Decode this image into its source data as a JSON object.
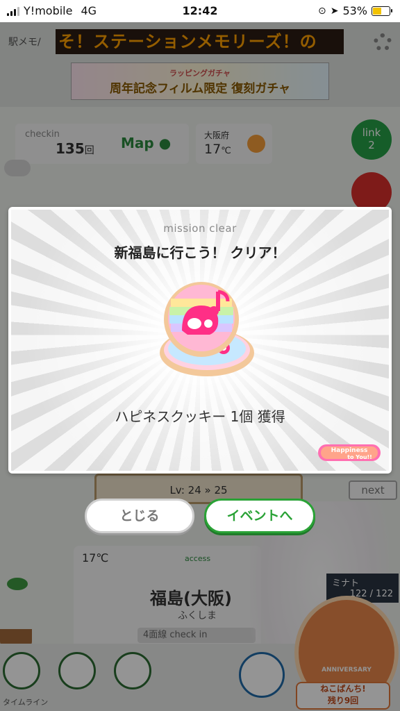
{
  "status_bar": {
    "carrier": "Y!mobile",
    "network": "4G",
    "time": "12:42",
    "battery_percent": "53%",
    "battery_level": 0.53
  },
  "background": {
    "memo_label": "駅メモ/",
    "marquee_text": "そ！ステーションメモリーズ！の",
    "banner": {
      "sub": "ラッピングガチャ",
      "main": "周年記念フィルム限定 復刻ガチャ"
    },
    "checkin": {
      "label": "checkin",
      "count": "135",
      "unit": "回",
      "map_label": "Map"
    },
    "weather": {
      "prefecture": "大阪府",
      "temperature": "17",
      "unit": "℃"
    },
    "link": {
      "label": "link",
      "count": "2"
    },
    "level": {
      "text": "Lv: 24 » 25"
    },
    "next_label": "next",
    "station_card": {
      "temperature": "17℃",
      "access_label": "access",
      "station_name": "福島(大阪)",
      "station_kana": "ふくしま",
      "check_label": "4面線 check in"
    },
    "character": {
      "name": "ミナト",
      "hp": "122 / 122"
    },
    "bottom_nav": {
      "timeline_label": "タイムライン"
    },
    "anniversary": {
      "badge_text": "ANNIVERSARY",
      "text_line1": "ねこぱんち!",
      "text_line2": "残り9回"
    }
  },
  "modal": {
    "subtitle": "mission clear",
    "title": "新福島に行こう！ クリア！",
    "reward_text": "ハピネスクッキー 1個 獲得",
    "logo_text_line1": "Happiness",
    "logo_text_line2": "to You!!"
  },
  "buttons": {
    "close_label": "とじる",
    "event_label": "イベントへ"
  },
  "colors": {
    "accent_green": "#2aa236",
    "marquee_orange": "#ffa000",
    "cookie_pink": "#ff2f86"
  }
}
